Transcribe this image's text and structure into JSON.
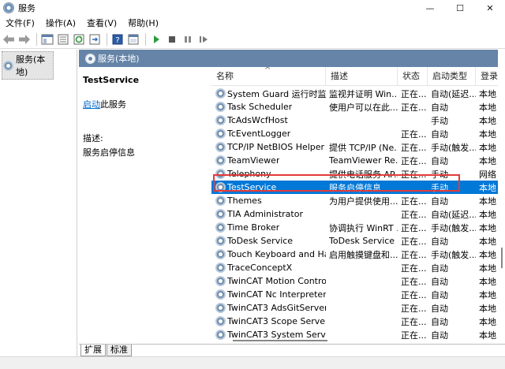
{
  "window": {
    "title": "服务",
    "minimize": "—",
    "maximize": "☐",
    "close": "✕"
  },
  "menu": [
    {
      "label": "文件(F)"
    },
    {
      "label": "操作(A)"
    },
    {
      "label": "查看(V)"
    },
    {
      "label": "帮助(H)"
    }
  ],
  "tree": {
    "label": "服务(本地)"
  },
  "panel": {
    "header": "服务(本地)"
  },
  "detail": {
    "service_name": "TestService",
    "start_link": "启动",
    "start_suffix": "此服务",
    "desc_label": "描述:",
    "desc_text": "服务启停信息"
  },
  "columns": {
    "name": "名称",
    "desc": "描述",
    "status": "状态",
    "start": "启动类型",
    "logon": "登录"
  },
  "rows": [
    {
      "name": "System Guard 运行时监视...",
      "desc": "监视并证明 Win...",
      "status": "正在...",
      "start": "自动(延迟...",
      "logon": "本地"
    },
    {
      "name": "Task Scheduler",
      "desc": "使用户可以在此...",
      "status": "正在...",
      "start": "自动",
      "logon": "本地"
    },
    {
      "name": "TcAdsWcfHost",
      "desc": "",
      "status": "",
      "start": "手动",
      "logon": "本地"
    },
    {
      "name": "TcEventLogger",
      "desc": "",
      "status": "正在...",
      "start": "自动",
      "logon": "本地"
    },
    {
      "name": "TCP/IP NetBIOS Helper",
      "desc": "提供 TCP/IP (Ne...",
      "status": "正在...",
      "start": "手动(触发...",
      "logon": "本地"
    },
    {
      "name": "TeamViewer",
      "desc": "TeamViewer Re...",
      "status": "正在...",
      "start": "自动",
      "logon": "本地"
    },
    {
      "name": "Telephony",
      "desc": "提供电话服务 AP...",
      "status": "正在...",
      "start": "手动",
      "logon": "网络"
    },
    {
      "name": "TestService",
      "desc": "服务启停信息",
      "status": "",
      "start": "手动",
      "logon": "本地",
      "selected": true
    },
    {
      "name": "Themes",
      "desc": "为用户提供使用...",
      "status": "正在...",
      "start": "自动",
      "logon": "本地"
    },
    {
      "name": "TIA Administrator",
      "desc": "",
      "status": "正在...",
      "start": "自动(延迟...",
      "logon": "本地"
    },
    {
      "name": "Time Broker",
      "desc": "协调执行 WinRT ...",
      "status": "正在...",
      "start": "手动(触发...",
      "logon": "本地"
    },
    {
      "name": "ToDesk Service",
      "desc": "ToDesk Service",
      "status": "正在...",
      "start": "自动",
      "logon": "本地"
    },
    {
      "name": "Touch Keyboard and Ha...",
      "desc": "启用触摸键盘和...",
      "status": "正在...",
      "start": "手动(触发...",
      "logon": "本地"
    },
    {
      "name": "TraceConceptX",
      "desc": "",
      "status": "正在...",
      "start": "自动",
      "logon": "本地"
    },
    {
      "name": "TwinCAT Motion Control ...",
      "desc": "",
      "status": "正在...",
      "start": "自动",
      "logon": "本地"
    },
    {
      "name": "TwinCAT Nc Interpreter",
      "desc": "",
      "status": "正在...",
      "start": "自动",
      "logon": "本地"
    },
    {
      "name": "TwinCAT3 AdsGitServer",
      "desc": "",
      "status": "正在...",
      "start": "自动",
      "logon": "本地"
    },
    {
      "name": "TwinCAT3 Scope Server",
      "desc": "",
      "status": "正在...",
      "start": "自动",
      "logon": "本地"
    },
    {
      "name": "TwinCAT3 System Service",
      "desc": "",
      "status": "正在...",
      "start": "自动",
      "logon": "本地"
    }
  ],
  "tabs": [
    {
      "label": "扩展"
    },
    {
      "label": "标准"
    }
  ],
  "colors": {
    "header_bg": "#6584a8",
    "selection": "#0078d7",
    "highlight_box": "#e23b3b",
    "link": "#0066cc"
  }
}
